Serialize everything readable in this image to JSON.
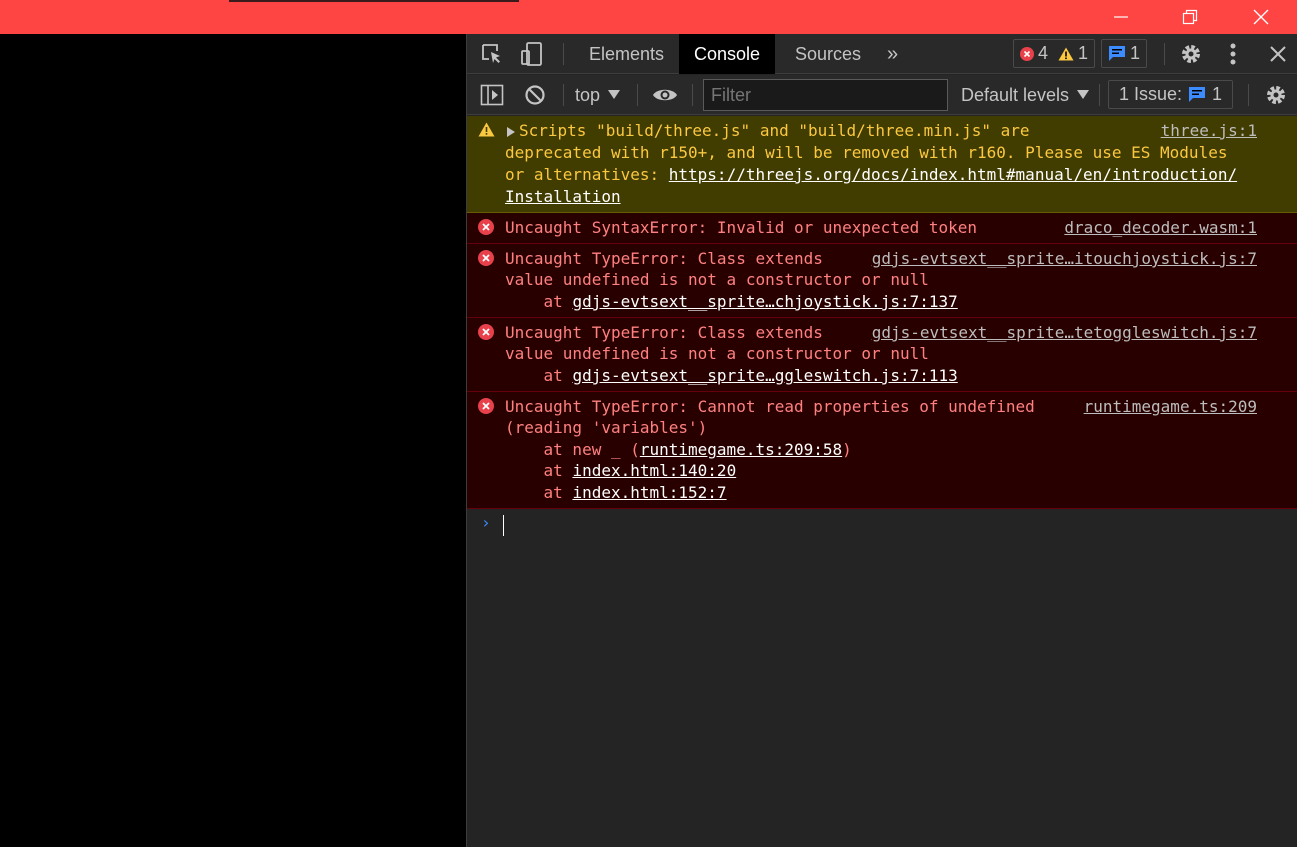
{
  "colors": {
    "titlebar": "#ff4444",
    "warn_bg": "#413c00",
    "warn_text": "#fbc841",
    "err_bg": "#290000",
    "err_text": "#ff8080",
    "link": "#ffffff",
    "accent_blue": "#3c8bff"
  },
  "window_controls": [
    "minimize-icon",
    "restore-icon",
    "close-icon"
  ],
  "devtools": {
    "tabs": [
      {
        "label": "Elements",
        "active": false
      },
      {
        "label": "Console",
        "active": true
      },
      {
        "label": "Sources",
        "active": false
      }
    ],
    "more_tabs_glyph": "»",
    "counts": {
      "errors": "4",
      "warnings": "1",
      "messages": "1"
    },
    "toolbar": {
      "context": "top",
      "filter_placeholder": "Filter",
      "levels": "Default levels",
      "issues_label": "1 Issue:",
      "issues_count": "1"
    }
  },
  "console": {
    "warning": {
      "line1": "Scripts \"build/three.js\" and \"build/three.min.js\" are",
      "line2": "deprecated with r150+, and will be removed with r160. Please use ES Modules",
      "line3_prefix": "or alternatives: ",
      "line3_link": "https://threejs.org/docs/index.html#manual/en/introduction/",
      "line4_link": "Installation",
      "source": "three.js:1"
    },
    "errors": [
      {
        "text": "Uncaught SyntaxError: Invalid or unexpected token",
        "source": "draco_decoder.wasm:1"
      },
      {
        "line1": "Uncaught TypeError: Class extends",
        "line2": "value undefined is not a constructor or null",
        "stack_prefix": "    at ",
        "stack_link": "gdjs-evtsext__sprite…chjoystick.js:7:137",
        "source": "gdjs-evtsext__sprite…itouchjoystick.js:7"
      },
      {
        "line1": "Uncaught TypeError: Class extends",
        "line2": "value undefined is not a constructor or null",
        "stack_prefix": "    at ",
        "stack_link": "gdjs-evtsext__sprite…ggleswitch.js:7:113",
        "source": "gdjs-evtsext__sprite…tetoggleswitch.js:7"
      },
      {
        "line1": "Uncaught TypeError: Cannot read properties of undefined",
        "line2": "(reading 'variables')",
        "stack1_prefix": "    at new _ (",
        "stack1_link": "runtimegame.ts:209:58",
        "stack1_suffix": ")",
        "stack2_prefix": "    at ",
        "stack2_link": "index.html:140:20",
        "stack3_prefix": "    at ",
        "stack3_link": "index.html:152:7",
        "source": "runtimegame.ts:209"
      }
    ],
    "prompt_glyph": "›"
  }
}
